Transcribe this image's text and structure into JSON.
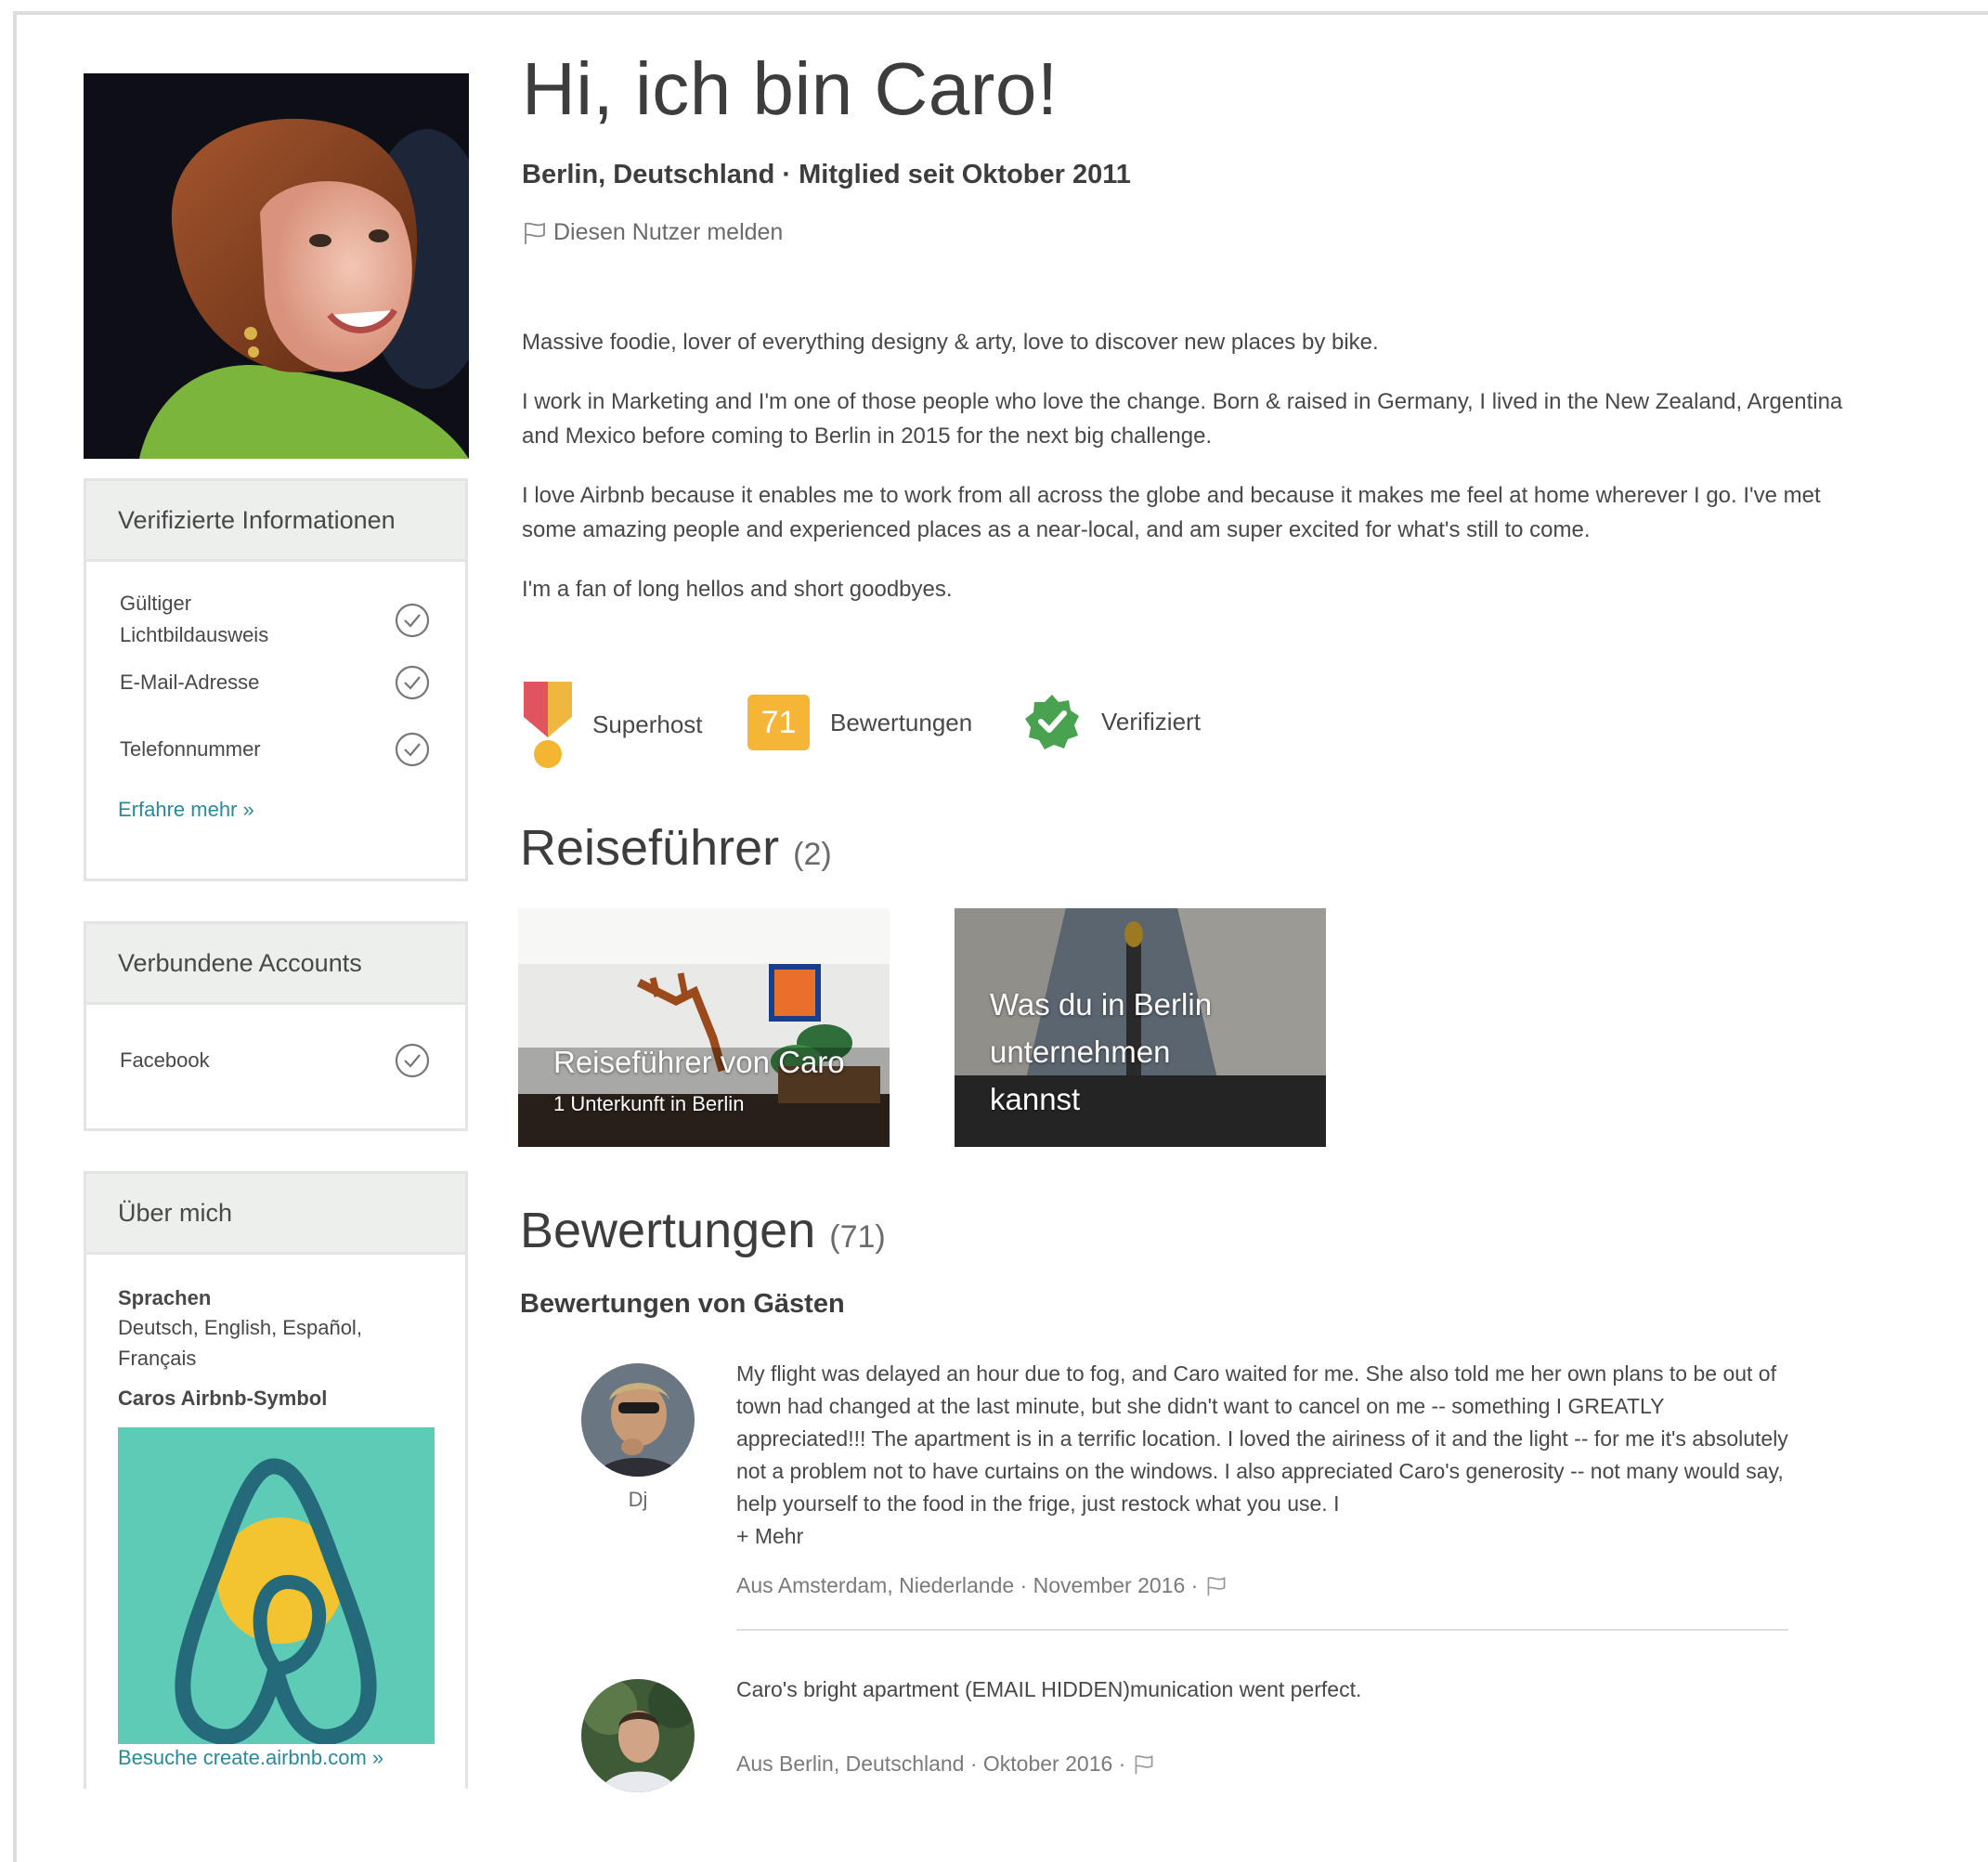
{
  "profile": {
    "title": "Hi, ich bin Caro!",
    "subline": "Berlin, Deutschland · Mitglied seit Oktober 2011",
    "report_label": "Diesen Nutzer melden",
    "bio": [
      "Massive foodie, lover of everything designy & arty, love to discover new places by bike.",
      "I work in Marketing and I'm one of those people who love the change. Born & raised in Germany, I lived in the New Zealand, Argentina and Mexico before coming to Berlin in 2015 for the next big challenge.",
      "I love Airbnb because it enables me to work from all across the globe and because it makes me feel at home wherever I go. I've met some amazing people and experienced places as a near-local, and am super excited for what's still to come.",
      "I'm a fan of long hellos and short goodbyes."
    ]
  },
  "badges": {
    "superhost": "Superhost",
    "reviews_count": "71",
    "reviews_label": "Bewertungen",
    "verified": "Verifiziert"
  },
  "verified_info": {
    "heading": "Verifizierte Informationen",
    "items": [
      "Gültiger Lichtbildausweis",
      "E-Mail-Adresse",
      "Telefonnummer"
    ],
    "link": "Erfahre mehr »"
  },
  "connected": {
    "heading": "Verbundene Accounts",
    "items": [
      "Facebook"
    ]
  },
  "about": {
    "heading": "Über mich",
    "languages_label": "Sprachen",
    "languages_value": "Deutsch, English, Español, Français",
    "symbol_label": "Caros Airbnb-Symbol",
    "symbol_link": "Besuche create.airbnb.com »",
    "symbol_bg": "#5ecbb7",
    "symbol_lemon": "#f4c430",
    "symbol_stroke": "#256a7a"
  },
  "guides": {
    "heading": "Reiseführer",
    "count": "(2)",
    "items": [
      {
        "title": "Reiseführer von Caro",
        "subtitle": "1 Unterkunft in Berlin"
      },
      {
        "title": "Was du in Berlin unternehmen kannst",
        "subtitle": ""
      }
    ]
  },
  "reviews": {
    "heading": "Bewertungen",
    "count": "(71)",
    "subheading": "Bewertungen von Gästen",
    "items": [
      {
        "name": "Dj",
        "text": "My flight was delayed an hour due to fog, and Caro waited for me. She also told me her own plans to be out of town had changed at the last minute, but she didn't want to cancel on me -- something I GREATLY appreciated!!! The apartment is in a terrific location. I loved the airiness of it and the light -- for me it's absolutely not a problem not to have curtains on the windows. I also appreciated Caro's generosity -- not many would say, help yourself to the food in the frige, just restock what you use. I",
        "more": "+ Mehr",
        "meta": "Aus Amsterdam, Niederlande · November 2016 ·"
      },
      {
        "name": "",
        "text": "Caro's bright apartment (EMAIL HIDDEN)munication went perfect.",
        "meta": "Aus Berlin, Deutschland · Oktober 2016 ·"
      }
    ]
  },
  "colors": {
    "link": "#2a8a9a",
    "superhost_ribbon": "#f0b740",
    "superhost_red": "#e0555d",
    "reviews_badge": "#f5b537",
    "verified_green": "#49a24f"
  }
}
